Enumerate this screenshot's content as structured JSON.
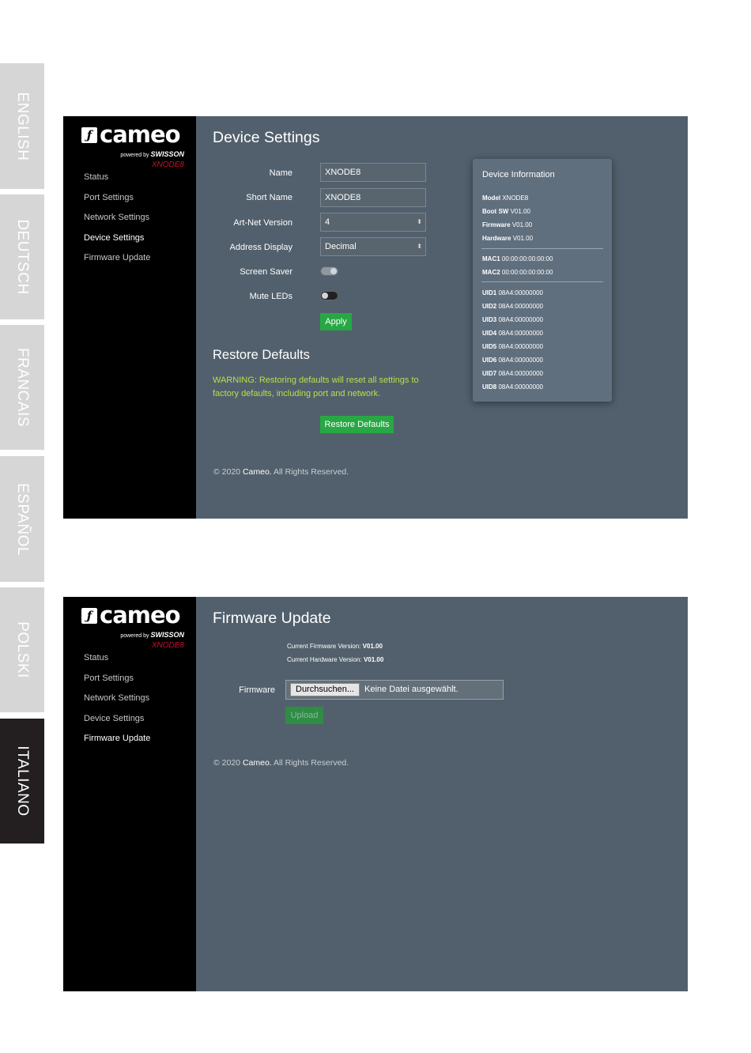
{
  "languages": [
    "ENGLISH",
    "DEUTSCH",
    "FRANCAIS",
    "ESPAÑOL",
    "POLSKI",
    "ITALIANO"
  ],
  "logo": {
    "name": "cameo",
    "powered_by": "powered by",
    "powered_brand": "SWISSON",
    "model": "XNODE8"
  },
  "nav": [
    "Status",
    "Port Settings",
    "Network Settings",
    "Device Settings",
    "Firmware Update"
  ],
  "device_settings": {
    "title": "Device Settings",
    "fields": {
      "name_label": "Name",
      "name_value": "XNODE8",
      "short_name_label": "Short Name",
      "short_name_value": "XNODE8",
      "artnet_label": "Art-Net Version",
      "artnet_value": "4",
      "address_label": "Address Display",
      "address_value": "Decimal",
      "screensaver_label": "Screen Saver",
      "screensaver_on": true,
      "mute_leds_label": "Mute LEDs",
      "mute_leds_on": false
    },
    "apply_label": "Apply",
    "restore_title": "Restore Defaults",
    "warning": "WARNING: Restoring defaults will reset all settings to factory defaults, including port and network.",
    "restore_button": "Restore Defaults",
    "footer_prefix": "© 2020",
    "footer_brand": "Cameo.",
    "footer_suffix": "All Rights Reserved.",
    "info": {
      "title": "Device Information",
      "rows": [
        {
          "k": "Model",
          "v": "XNODE8"
        },
        {
          "k": "Boot SW",
          "v": "V01.00"
        },
        {
          "k": "Firmware",
          "v": "V01.00"
        },
        {
          "k": "Hardware",
          "v": "V01.00"
        },
        {
          "k": "MAC1",
          "v": "00:00:00:00:00:00"
        },
        {
          "k": "MAC2",
          "v": "00:00:00:00:00:00"
        },
        {
          "k": "UID1",
          "v": "08A4:00000000"
        },
        {
          "k": "UID2",
          "v": "08A4:00000000"
        },
        {
          "k": "UID3",
          "v": "08A4:00000000"
        },
        {
          "k": "UID4",
          "v": "08A4:00000000"
        },
        {
          "k": "UID5",
          "v": "08A4:00000000"
        },
        {
          "k": "UID6",
          "v": "08A4:00000000"
        },
        {
          "k": "UID7",
          "v": "08A4:00000000"
        },
        {
          "k": "UID8",
          "v": "08A4:00000000"
        }
      ]
    }
  },
  "firmware_update": {
    "title": "Firmware Update",
    "current_fw_label": "Current Firmware Version:",
    "current_fw_value": "V01.00",
    "current_hw_label": "Current Hardware Version:",
    "current_hw_value": "V01.00",
    "firmware_label": "Firmware",
    "browse_button": "Durchsuchen...",
    "no_file": "Keine Datei ausgewählt.",
    "upload_label": "Upload",
    "footer_prefix": "© 2020",
    "footer_brand": "Cameo.",
    "footer_suffix": "All Rights Reserved."
  }
}
